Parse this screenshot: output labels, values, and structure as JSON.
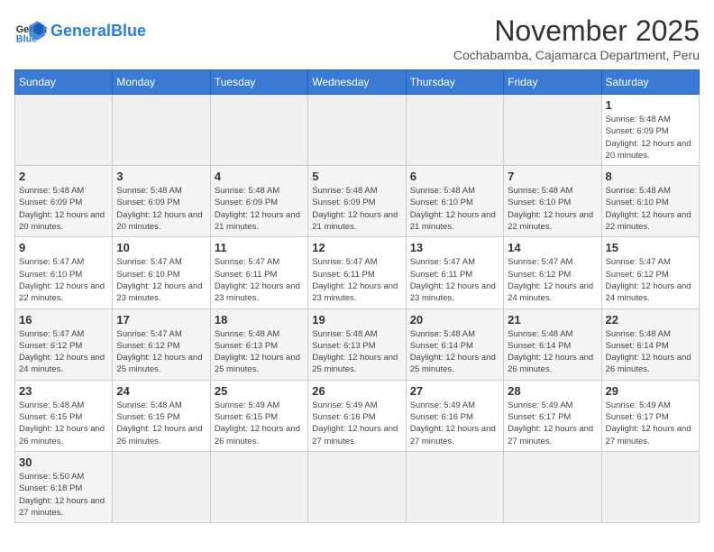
{
  "header": {
    "logo_general": "General",
    "logo_blue": "Blue",
    "month_title": "November 2025",
    "subtitle": "Cochabamba, Cajamarca Department, Peru"
  },
  "days_of_week": [
    "Sunday",
    "Monday",
    "Tuesday",
    "Wednesday",
    "Thursday",
    "Friday",
    "Saturday"
  ],
  "weeks": [
    [
      {
        "day": "",
        "info": ""
      },
      {
        "day": "",
        "info": ""
      },
      {
        "day": "",
        "info": ""
      },
      {
        "day": "",
        "info": ""
      },
      {
        "day": "",
        "info": ""
      },
      {
        "day": "",
        "info": ""
      },
      {
        "day": "1",
        "info": "Sunrise: 5:48 AM\nSunset: 6:09 PM\nDaylight: 12 hours\nand 20 minutes."
      }
    ],
    [
      {
        "day": "2",
        "info": "Sunrise: 5:48 AM\nSunset: 6:09 PM\nDaylight: 12 hours\nand 20 minutes."
      },
      {
        "day": "3",
        "info": "Sunrise: 5:48 AM\nSunset: 6:09 PM\nDaylight: 12 hours\nand 20 minutes."
      },
      {
        "day": "4",
        "info": "Sunrise: 5:48 AM\nSunset: 6:09 PM\nDaylight: 12 hours\nand 21 minutes."
      },
      {
        "day": "5",
        "info": "Sunrise: 5:48 AM\nSunset: 6:09 PM\nDaylight: 12 hours\nand 21 minutes."
      },
      {
        "day": "6",
        "info": "Sunrise: 5:48 AM\nSunset: 6:10 PM\nDaylight: 12 hours\nand 21 minutes."
      },
      {
        "day": "7",
        "info": "Sunrise: 5:48 AM\nSunset: 6:10 PM\nDaylight: 12 hours\nand 22 minutes."
      },
      {
        "day": "8",
        "info": "Sunrise: 5:48 AM\nSunset: 6:10 PM\nDaylight: 12 hours\nand 22 minutes."
      }
    ],
    [
      {
        "day": "9",
        "info": "Sunrise: 5:47 AM\nSunset: 6:10 PM\nDaylight: 12 hours\nand 22 minutes."
      },
      {
        "day": "10",
        "info": "Sunrise: 5:47 AM\nSunset: 6:10 PM\nDaylight: 12 hours\nand 23 minutes."
      },
      {
        "day": "11",
        "info": "Sunrise: 5:47 AM\nSunset: 6:11 PM\nDaylight: 12 hours\nand 23 minutes."
      },
      {
        "day": "12",
        "info": "Sunrise: 5:47 AM\nSunset: 6:11 PM\nDaylight: 12 hours\nand 23 minutes."
      },
      {
        "day": "13",
        "info": "Sunrise: 5:47 AM\nSunset: 6:11 PM\nDaylight: 12 hours\nand 23 minutes."
      },
      {
        "day": "14",
        "info": "Sunrise: 5:47 AM\nSunset: 6:12 PM\nDaylight: 12 hours\nand 24 minutes."
      },
      {
        "day": "15",
        "info": "Sunrise: 5:47 AM\nSunset: 6:12 PM\nDaylight: 12 hours\nand 24 minutes."
      }
    ],
    [
      {
        "day": "16",
        "info": "Sunrise: 5:47 AM\nSunset: 6:12 PM\nDaylight: 12 hours\nand 24 minutes."
      },
      {
        "day": "17",
        "info": "Sunrise: 5:47 AM\nSunset: 6:12 PM\nDaylight: 12 hours\nand 25 minutes."
      },
      {
        "day": "18",
        "info": "Sunrise: 5:48 AM\nSunset: 6:13 PM\nDaylight: 12 hours\nand 25 minutes."
      },
      {
        "day": "19",
        "info": "Sunrise: 5:48 AM\nSunset: 6:13 PM\nDaylight: 12 hours\nand 25 minutes."
      },
      {
        "day": "20",
        "info": "Sunrise: 5:48 AM\nSunset: 6:14 PM\nDaylight: 12 hours\nand 25 minutes."
      },
      {
        "day": "21",
        "info": "Sunrise: 5:48 AM\nSunset: 6:14 PM\nDaylight: 12 hours\nand 26 minutes."
      },
      {
        "day": "22",
        "info": "Sunrise: 5:48 AM\nSunset: 6:14 PM\nDaylight: 12 hours\nand 26 minutes."
      }
    ],
    [
      {
        "day": "23",
        "info": "Sunrise: 5:48 AM\nSunset: 6:15 PM\nDaylight: 12 hours\nand 26 minutes."
      },
      {
        "day": "24",
        "info": "Sunrise: 5:48 AM\nSunset: 6:15 PM\nDaylight: 12 hours\nand 26 minutes."
      },
      {
        "day": "25",
        "info": "Sunrise: 5:49 AM\nSunset: 6:15 PM\nDaylight: 12 hours\nand 26 minutes."
      },
      {
        "day": "26",
        "info": "Sunrise: 5:49 AM\nSunset: 6:16 PM\nDaylight: 12 hours\nand 27 minutes."
      },
      {
        "day": "27",
        "info": "Sunrise: 5:49 AM\nSunset: 6:16 PM\nDaylight: 12 hours\nand 27 minutes."
      },
      {
        "day": "28",
        "info": "Sunrise: 5:49 AM\nSunset: 6:17 PM\nDaylight: 12 hours\nand 27 minutes."
      },
      {
        "day": "29",
        "info": "Sunrise: 5:49 AM\nSunset: 6:17 PM\nDaylight: 12 hours\nand 27 minutes."
      }
    ],
    [
      {
        "day": "30",
        "info": "Sunrise: 5:50 AM\nSunset: 6:18 PM\nDaylight: 12 hours\nand 27 minutes."
      },
      {
        "day": "",
        "info": ""
      },
      {
        "day": "",
        "info": ""
      },
      {
        "day": "",
        "info": ""
      },
      {
        "day": "",
        "info": ""
      },
      {
        "day": "",
        "info": ""
      },
      {
        "day": "",
        "info": ""
      }
    ]
  ]
}
